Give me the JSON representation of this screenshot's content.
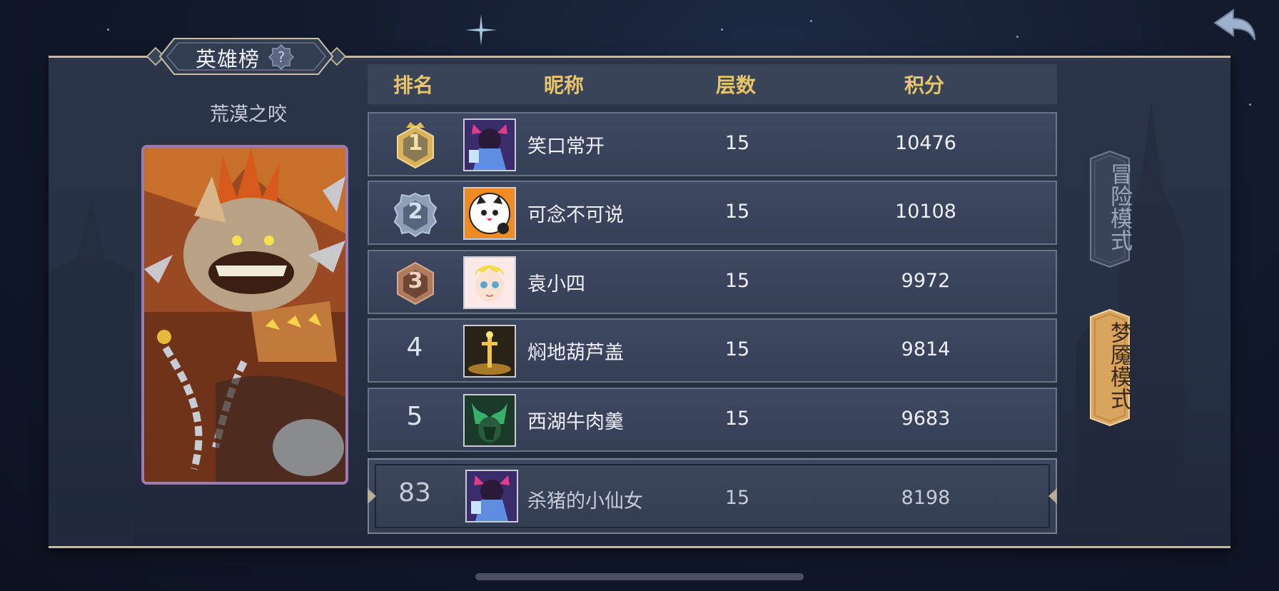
{
  "title": "英雄榜",
  "level_name": "荒漠之咬",
  "columns": [
    "排名",
    "昵称",
    "层数",
    "积分"
  ],
  "rows": [
    {
      "rank": "1",
      "nickname": "笑口常开",
      "layers": "15",
      "score": "10476"
    },
    {
      "rank": "2",
      "nickname": "可念不可说",
      "layers": "15",
      "score": "10108"
    },
    {
      "rank": "3",
      "nickname": "袁小四",
      "layers": "15",
      "score": "9972"
    },
    {
      "rank": "4",
      "nickname": "焖地葫芦盖",
      "layers": "15",
      "score": "9814"
    },
    {
      "rank": "5",
      "nickname": "西湖牛肉羹",
      "layers": "15",
      "score": "9683"
    }
  ],
  "my_row": {
    "rank": "83",
    "nickname": "杀猪的小仙女",
    "layers": "15",
    "score": "8198"
  },
  "modes": {
    "adventure": "冒险模式",
    "nightmare": "梦魇模式",
    "selected": "nightmare"
  },
  "colors": {
    "header_gold": "#e9c56a",
    "gold_medal": "#d9b25a",
    "silver_medal": "#8f9fb8",
    "bronze_medal": "#b07a5e",
    "nightmare_active": "#d9a45e"
  },
  "icons": {
    "back": "back-arrow-icon",
    "help": "help-question-icon"
  }
}
